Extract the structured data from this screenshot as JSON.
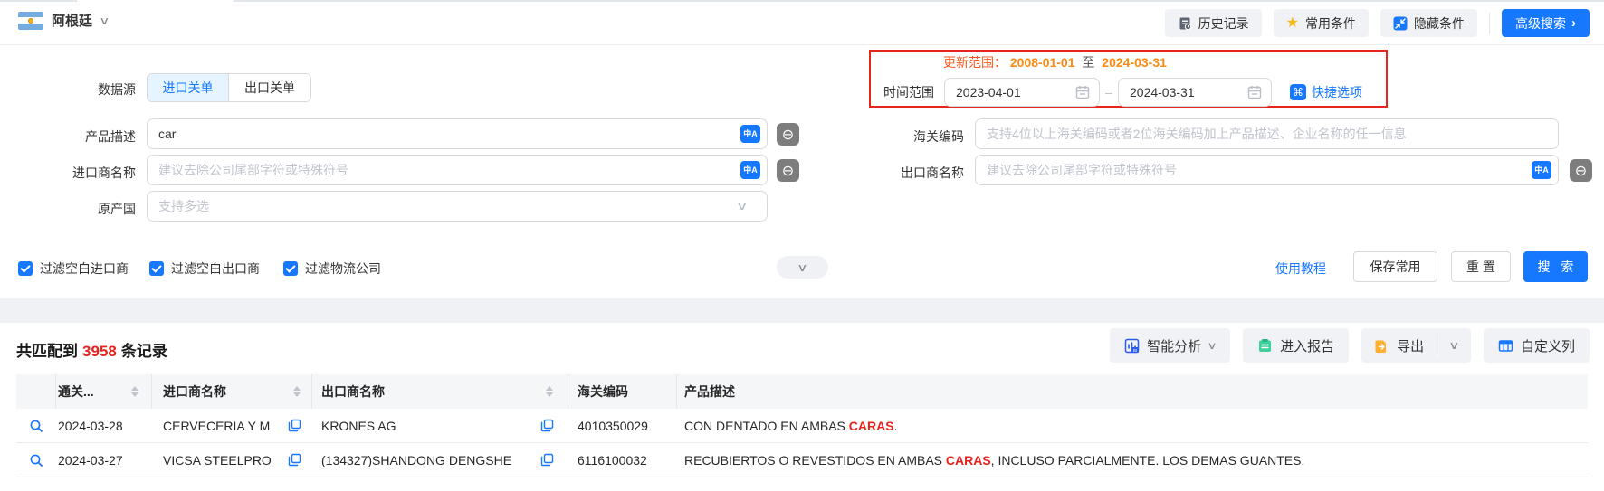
{
  "topbar": {
    "country": "阿根廷",
    "history_btn": "历史记录",
    "favorites_btn": "常用条件",
    "hide_btn": "隐藏条件",
    "advanced_btn": "高级搜索"
  },
  "form": {
    "datasource_label": "数据源",
    "tab_import": "进口关单",
    "tab_export": "出口关单",
    "update_range_label": "更新范围：",
    "update_start": "2008-01-01",
    "update_to": "至",
    "update_end": "2024-03-31",
    "time_range_label": "时间范围",
    "date_start": "2023-04-01",
    "date_sep": "–",
    "date_end": "2024-03-31",
    "quick_options": "快捷选项",
    "product_label": "产品描述",
    "product_value": "car",
    "hs_label": "海关编码",
    "hs_placeholder": "支持4位以上海关编码或者2位海关编码加上产品描述、企业名称的任一信息",
    "importer_label": "进口商名称",
    "importer_placeholder": "建议去除公司尾部字符或特殊符号",
    "exporter_label": "出口商名称",
    "exporter_placeholder": "建议去除公司尾部字符或特殊符号",
    "origin_label": "原产国",
    "origin_placeholder": "支持多选",
    "checkboxes": [
      "过滤空白进口商",
      "过滤空白出口商",
      "过滤物流公司"
    ],
    "tutorial_link": "使用教程",
    "save_btn": "保存常用",
    "reset_btn": "重 置",
    "search_btn": "搜 索"
  },
  "results": {
    "summary_prefix": "共匹配到",
    "summary_count": "3958",
    "summary_suffix": "条记录",
    "analyze_btn": "智能分析",
    "report_btn": "进入报告",
    "export_btn": "导出",
    "customize_btn": "自定义列",
    "table": {
      "headers": [
        "通关...",
        "进口商名称",
        "出口商名称",
        "海关编码",
        "产品描述"
      ],
      "rows": [
        {
          "date": "2024-03-28",
          "importer": "CERVECERIA Y M",
          "exporter": "KRONES AG",
          "hs_code": "4010350029",
          "desc_pre": "CON DENTADO EN AMBAS ",
          "desc_highlight": "CARAS",
          "desc_post": "."
        },
        {
          "date": "2024-03-27",
          "importer": "VICSA STEELPRO",
          "exporter": "(134327)SHANDONG DENGSHE",
          "hs_code": "6116100032",
          "desc_pre": "RECUBIERTOS O REVESTIDOS EN AMBAS ",
          "desc_highlight": "CARAS",
          "desc_post": ", INCLUSO PARCIALMENTE. LOS DEMAS GUANTES."
        }
      ]
    }
  },
  "icons": {
    "chevron_down": "∨",
    "chevron_right": "›",
    "star": "★",
    "command": "⌘",
    "translate": "中A",
    "exclude": "⊖"
  },
  "colors": {
    "accent_blue": "#1677ff",
    "highlight_red": "#e8231d",
    "update_orange": "#fa8c16",
    "redbox_border": "#e8241d"
  }
}
